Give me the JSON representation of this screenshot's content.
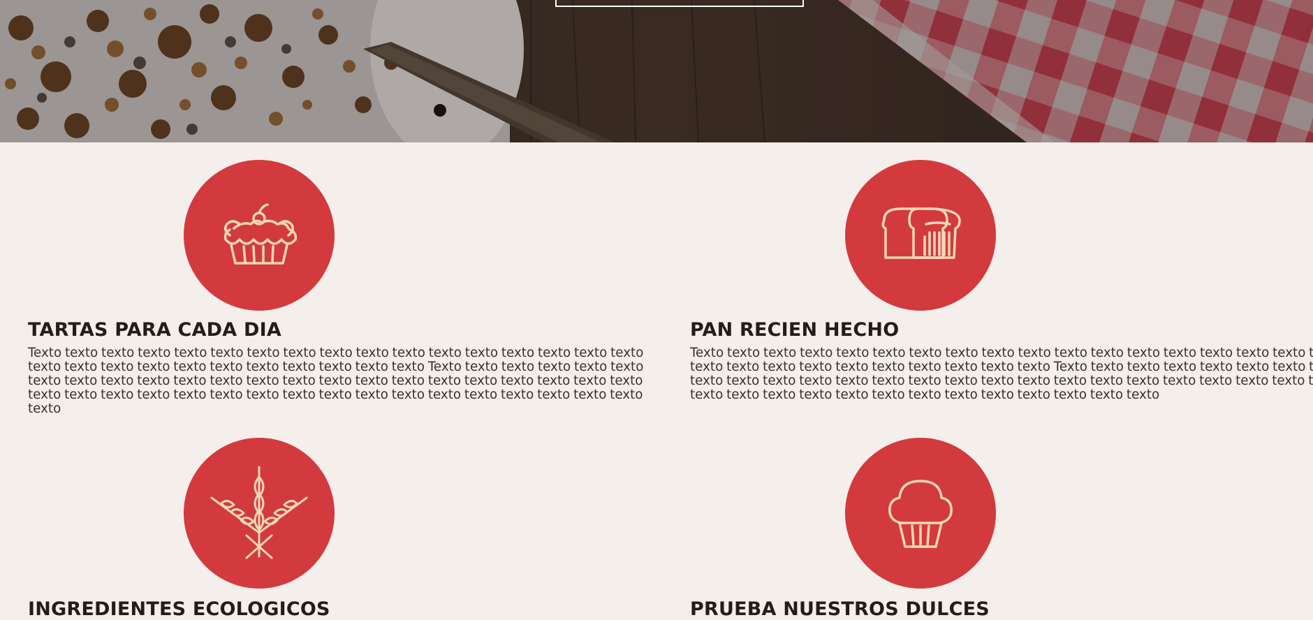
{
  "hero": {
    "button_label": ""
  },
  "features": [
    {
      "icon": "pie-icon",
      "title": "TARTAS PARA CADA DIA",
      "text": "Texto texto texto texto texto texto texto texto texto texto texto texto texto texto texto texto texto texto texto texto texto texto texto texto texto texto texto texto Texto texto texto texto texto texto texto texto texto texto texto texto texto texto texto texto texto texto texto texto texto texto texto texto texto texto texto texto texto texto texto texto texto texto texto texto texto texto texto texto texto"
    },
    {
      "icon": "bread-icon",
      "title": "PAN RECIEN HECHO",
      "text": "Texto texto texto texto texto texto texto texto texto texto texto texto texto texto texto texto texto texto texto texto texto texto texto texto texto texto texto texto texto Texto texto texto texto texto texto texto texto texto texto texto texto texto texto texto texto texto texto texto texto texto texto texto texto texto texto texto texto texto texto texto texto texto texto texto texto texto texto texto texto texto"
    },
    {
      "icon": "wheat-icon",
      "title": "INGREDIENTES ECOLOGICOS",
      "text": ""
    },
    {
      "icon": "cupcake-icon",
      "title": "PRUEBA NUESTROS DULCES",
      "text": ""
    }
  ],
  "colors": {
    "accent": "#d33a3d",
    "icon_stroke": "#f2d7b8",
    "background": "#f5efec",
    "heading": "#231c19"
  }
}
